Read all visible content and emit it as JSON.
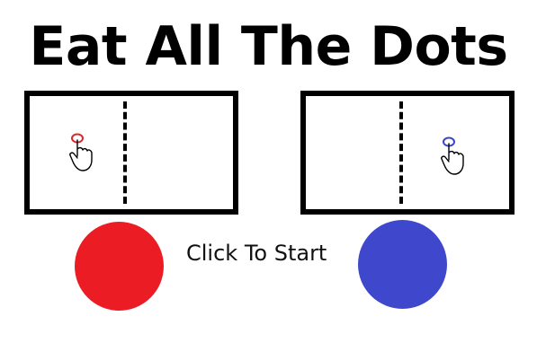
{
  "game": {
    "title": "Eat All The Dots",
    "start_label": "Click To Start"
  },
  "panels": [
    {
      "side": "left",
      "tap_color": "#d42a30"
    },
    {
      "side": "right",
      "tap_color": "#3b45c8"
    }
  ],
  "players": [
    {
      "name": "red",
      "color": "#ec1c24"
    },
    {
      "name": "blue",
      "color": "#3f48cc"
    }
  ],
  "icons": {
    "tap": "tap-hand-icon"
  }
}
